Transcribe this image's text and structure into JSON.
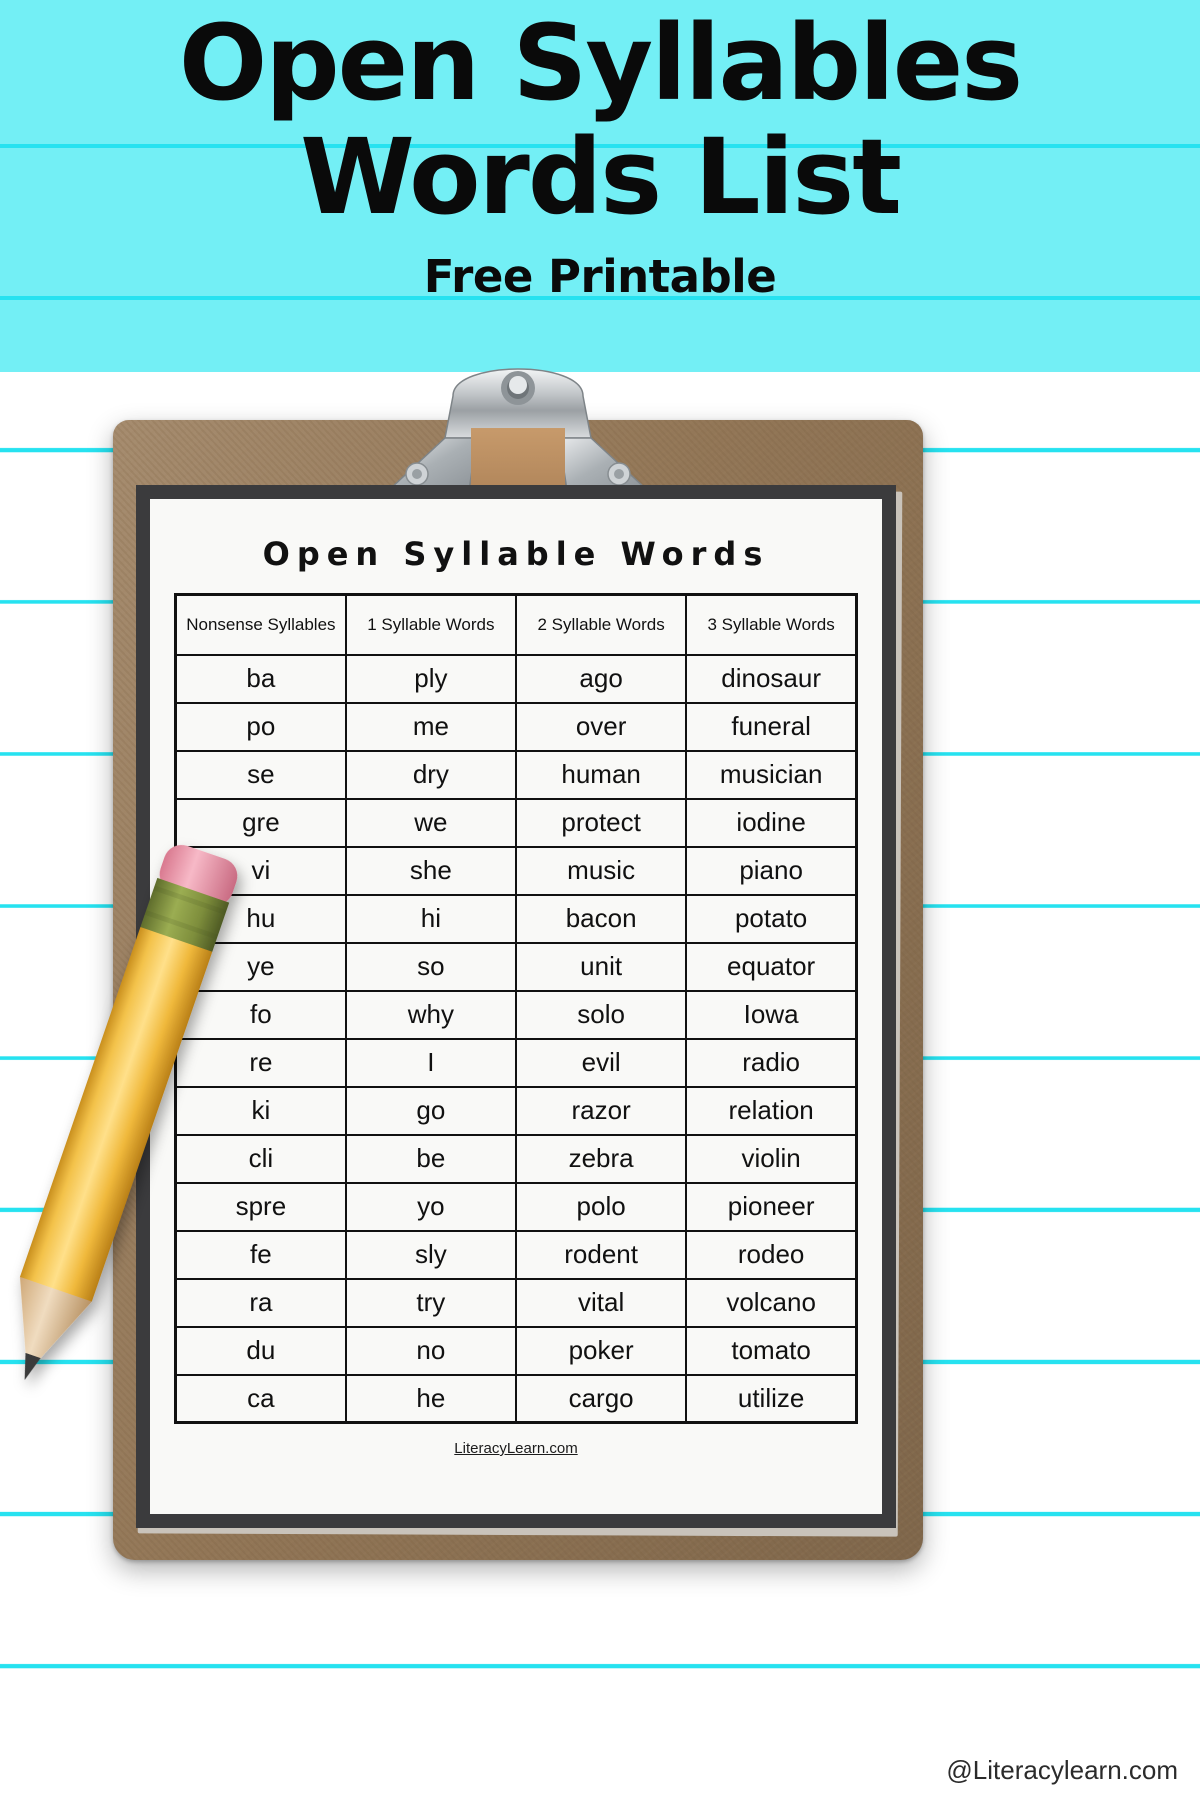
{
  "banner": {
    "title_line1": "Open Syllables",
    "title_line2": "Words List",
    "subtitle": "Free Printable",
    "bg_color": "#73eff5",
    "line_color": "#26e2f0"
  },
  "worksheet": {
    "title": "Open Syllable Words",
    "paper_color": "#f9f9f7",
    "border_color": "#3b3b3d",
    "footer_credit": "LiteracyLearn.com",
    "columns": [
      "Nonsense Syllables",
      "1 Syllable Words",
      "2 Syllable Words",
      "3 Syllable Words"
    ],
    "rows": [
      [
        "ba",
        "ply",
        "ago",
        "dinosaur"
      ],
      [
        "po",
        "me",
        "over",
        "funeral"
      ],
      [
        "se",
        "dry",
        "human",
        "musician"
      ],
      [
        "gre",
        "we",
        "protect",
        "iodine"
      ],
      [
        "vi",
        "she",
        "music",
        "piano"
      ],
      [
        "hu",
        "hi",
        "bacon",
        "potato"
      ],
      [
        "ye",
        "so",
        "unit",
        "equator"
      ],
      [
        "fo",
        "why",
        "solo",
        "Iowa"
      ],
      [
        "re",
        "I",
        "evil",
        "radio"
      ],
      [
        "ki",
        "go",
        "razor",
        "relation"
      ],
      [
        "cli",
        "be",
        "zebra",
        "violin"
      ],
      [
        "spre",
        "yo",
        "polo",
        "pioneer"
      ],
      [
        "fe",
        "sly",
        "rodent",
        "rodeo"
      ],
      [
        "ra",
        "try",
        "vital",
        "volcano"
      ],
      [
        "du",
        "no",
        "poker",
        "tomato"
      ],
      [
        "ca",
        "he",
        "cargo",
        "utilize"
      ]
    ]
  },
  "clipboard": {
    "board_color": "#9a7d5c",
    "clip_color": "#c7cacc"
  },
  "pencil": {
    "body_color": "#f5c040",
    "eraser_color": "#f2a3b6",
    "ferrule_color": "#8a9a4a"
  },
  "watermark": "@Literacylearn.com"
}
